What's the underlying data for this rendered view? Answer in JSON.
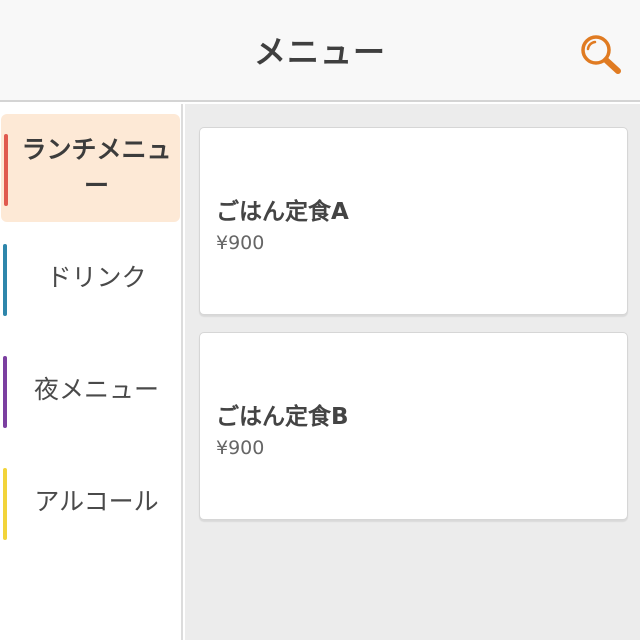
{
  "header": {
    "title": "メニュー",
    "search_icon": "search-icon",
    "accent_color": "#e07b22"
  },
  "sidebar": {
    "items": [
      {
        "label": "ランチメニュー",
        "color": "#e05a4f",
        "active": true
      },
      {
        "label": "ドリンク",
        "color": "#2e86ab",
        "active": false
      },
      {
        "label": "夜メニュー",
        "color": "#7b3fa0",
        "active": false
      },
      {
        "label": "アルコール",
        "color": "#f2d43a",
        "active": false
      }
    ],
    "active_background": "#fde9d6"
  },
  "menu": {
    "items": [
      {
        "name": "ごはん定食A",
        "price": "¥900"
      },
      {
        "name": "ごはん定食B",
        "price": "¥900"
      }
    ]
  }
}
